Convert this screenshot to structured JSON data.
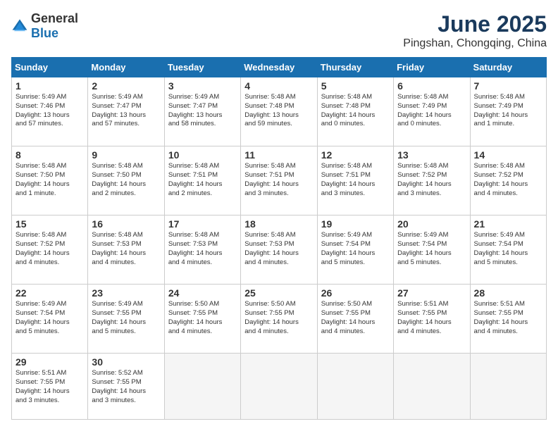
{
  "header": {
    "logo_general": "General",
    "logo_blue": "Blue",
    "main_title": "June 2025",
    "subtitle": "Pingshan, Chongqing, China"
  },
  "calendar": {
    "days": [
      "Sunday",
      "Monday",
      "Tuesday",
      "Wednesday",
      "Thursday",
      "Friday",
      "Saturday"
    ],
    "rows": [
      [
        {
          "day": "1",
          "text": "Sunrise: 5:49 AM\nSunset: 7:46 PM\nDaylight: 13 hours\nand 57 minutes."
        },
        {
          "day": "2",
          "text": "Sunrise: 5:49 AM\nSunset: 7:47 PM\nDaylight: 13 hours\nand 57 minutes."
        },
        {
          "day": "3",
          "text": "Sunrise: 5:49 AM\nSunset: 7:47 PM\nDaylight: 13 hours\nand 58 minutes."
        },
        {
          "day": "4",
          "text": "Sunrise: 5:48 AM\nSunset: 7:48 PM\nDaylight: 13 hours\nand 59 minutes."
        },
        {
          "day": "5",
          "text": "Sunrise: 5:48 AM\nSunset: 7:48 PM\nDaylight: 14 hours\nand 0 minutes."
        },
        {
          "day": "6",
          "text": "Sunrise: 5:48 AM\nSunset: 7:49 PM\nDaylight: 14 hours\nand 0 minutes."
        },
        {
          "day": "7",
          "text": "Sunrise: 5:48 AM\nSunset: 7:49 PM\nDaylight: 14 hours\nand 1 minute."
        }
      ],
      [
        {
          "day": "8",
          "text": "Sunrise: 5:48 AM\nSunset: 7:50 PM\nDaylight: 14 hours\nand 1 minute."
        },
        {
          "day": "9",
          "text": "Sunrise: 5:48 AM\nSunset: 7:50 PM\nDaylight: 14 hours\nand 2 minutes."
        },
        {
          "day": "10",
          "text": "Sunrise: 5:48 AM\nSunset: 7:51 PM\nDaylight: 14 hours\nand 2 minutes."
        },
        {
          "day": "11",
          "text": "Sunrise: 5:48 AM\nSunset: 7:51 PM\nDaylight: 14 hours\nand 3 minutes."
        },
        {
          "day": "12",
          "text": "Sunrise: 5:48 AM\nSunset: 7:51 PM\nDaylight: 14 hours\nand 3 minutes."
        },
        {
          "day": "13",
          "text": "Sunrise: 5:48 AM\nSunset: 7:52 PM\nDaylight: 14 hours\nand 3 minutes."
        },
        {
          "day": "14",
          "text": "Sunrise: 5:48 AM\nSunset: 7:52 PM\nDaylight: 14 hours\nand 4 minutes."
        }
      ],
      [
        {
          "day": "15",
          "text": "Sunrise: 5:48 AM\nSunset: 7:52 PM\nDaylight: 14 hours\nand 4 minutes."
        },
        {
          "day": "16",
          "text": "Sunrise: 5:48 AM\nSunset: 7:53 PM\nDaylight: 14 hours\nand 4 minutes."
        },
        {
          "day": "17",
          "text": "Sunrise: 5:48 AM\nSunset: 7:53 PM\nDaylight: 14 hours\nand 4 minutes."
        },
        {
          "day": "18",
          "text": "Sunrise: 5:48 AM\nSunset: 7:53 PM\nDaylight: 14 hours\nand 4 minutes."
        },
        {
          "day": "19",
          "text": "Sunrise: 5:49 AM\nSunset: 7:54 PM\nDaylight: 14 hours\nand 5 minutes."
        },
        {
          "day": "20",
          "text": "Sunrise: 5:49 AM\nSunset: 7:54 PM\nDaylight: 14 hours\nand 5 minutes."
        },
        {
          "day": "21",
          "text": "Sunrise: 5:49 AM\nSunset: 7:54 PM\nDaylight: 14 hours\nand 5 minutes."
        }
      ],
      [
        {
          "day": "22",
          "text": "Sunrise: 5:49 AM\nSunset: 7:54 PM\nDaylight: 14 hours\nand 5 minutes."
        },
        {
          "day": "23",
          "text": "Sunrise: 5:49 AM\nSunset: 7:55 PM\nDaylight: 14 hours\nand 5 minutes."
        },
        {
          "day": "24",
          "text": "Sunrise: 5:50 AM\nSunset: 7:55 PM\nDaylight: 14 hours\nand 4 minutes."
        },
        {
          "day": "25",
          "text": "Sunrise: 5:50 AM\nSunset: 7:55 PM\nDaylight: 14 hours\nand 4 minutes."
        },
        {
          "day": "26",
          "text": "Sunrise: 5:50 AM\nSunset: 7:55 PM\nDaylight: 14 hours\nand 4 minutes."
        },
        {
          "day": "27",
          "text": "Sunrise: 5:51 AM\nSunset: 7:55 PM\nDaylight: 14 hours\nand 4 minutes."
        },
        {
          "day": "28",
          "text": "Sunrise: 5:51 AM\nSunset: 7:55 PM\nDaylight: 14 hours\nand 4 minutes."
        }
      ],
      [
        {
          "day": "29",
          "text": "Sunrise: 5:51 AM\nSunset: 7:55 PM\nDaylight: 14 hours\nand 3 minutes."
        },
        {
          "day": "30",
          "text": "Sunrise: 5:52 AM\nSunset: 7:55 PM\nDaylight: 14 hours\nand 3 minutes."
        },
        {
          "day": "",
          "text": ""
        },
        {
          "day": "",
          "text": ""
        },
        {
          "day": "",
          "text": ""
        },
        {
          "day": "",
          "text": ""
        },
        {
          "day": "",
          "text": ""
        }
      ]
    ]
  }
}
